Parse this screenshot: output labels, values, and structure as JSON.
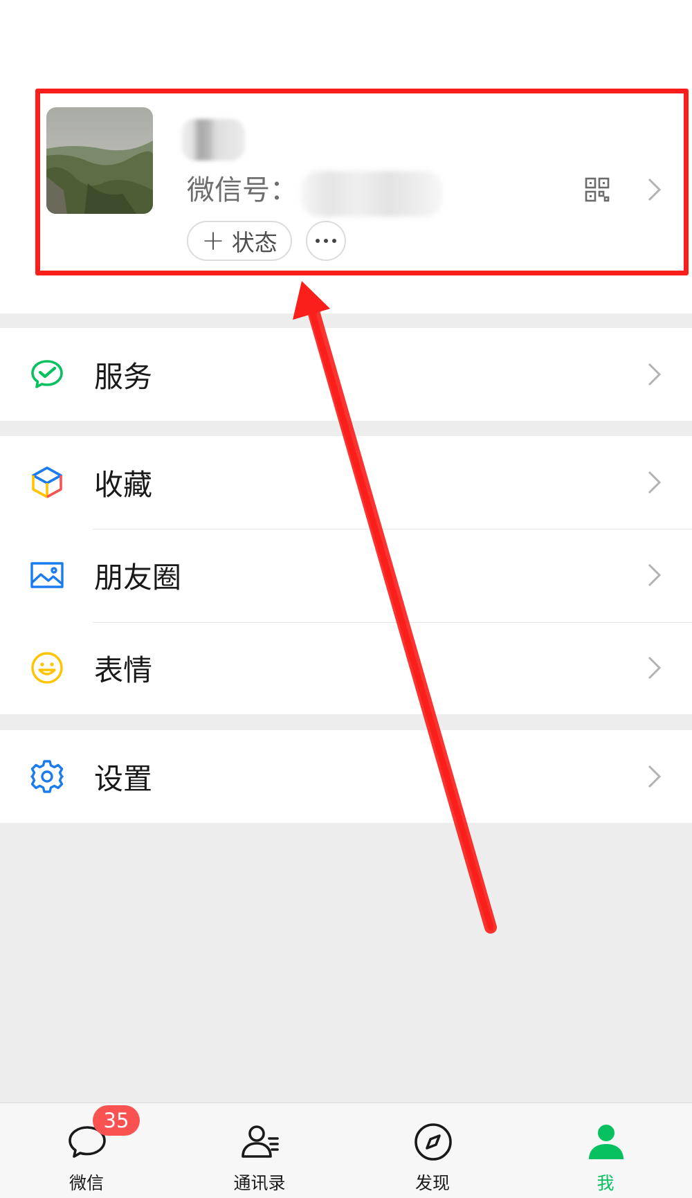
{
  "profile": {
    "wechat_id_label": "微信号：",
    "status_button_label": "状态",
    "status_button_plus": "+",
    "qr_icon": "qr-code-icon",
    "more_icon": "more-dots-icon",
    "chevron_icon": "chevron-right-icon"
  },
  "menu": {
    "service": {
      "label": "服务",
      "icon": "wechat-pay-icon",
      "color": "#07c160"
    },
    "favorites": {
      "label": "收藏",
      "icon": "cube-icon"
    },
    "moments": {
      "label": "朋友圈",
      "icon": "picture-icon",
      "color": "#1a7bef"
    },
    "stickers": {
      "label": "表情",
      "icon": "smiley-icon",
      "color": "#ffc300"
    },
    "settings": {
      "label": "设置",
      "icon": "gear-icon",
      "color": "#1a7bef"
    }
  },
  "tabbar": {
    "chats": {
      "label": "微信",
      "badge": "35",
      "icon": "chat-bubble-icon"
    },
    "contacts": {
      "label": "通讯录",
      "icon": "contacts-icon"
    },
    "discover": {
      "label": "发现",
      "icon": "compass-icon"
    },
    "me": {
      "label": "我",
      "icon": "person-icon",
      "active": true
    }
  },
  "colors": {
    "accent_green": "#07c160",
    "badge_red": "#fa5151",
    "annotation_red": "#fa1f1a",
    "background": "#ededed"
  }
}
